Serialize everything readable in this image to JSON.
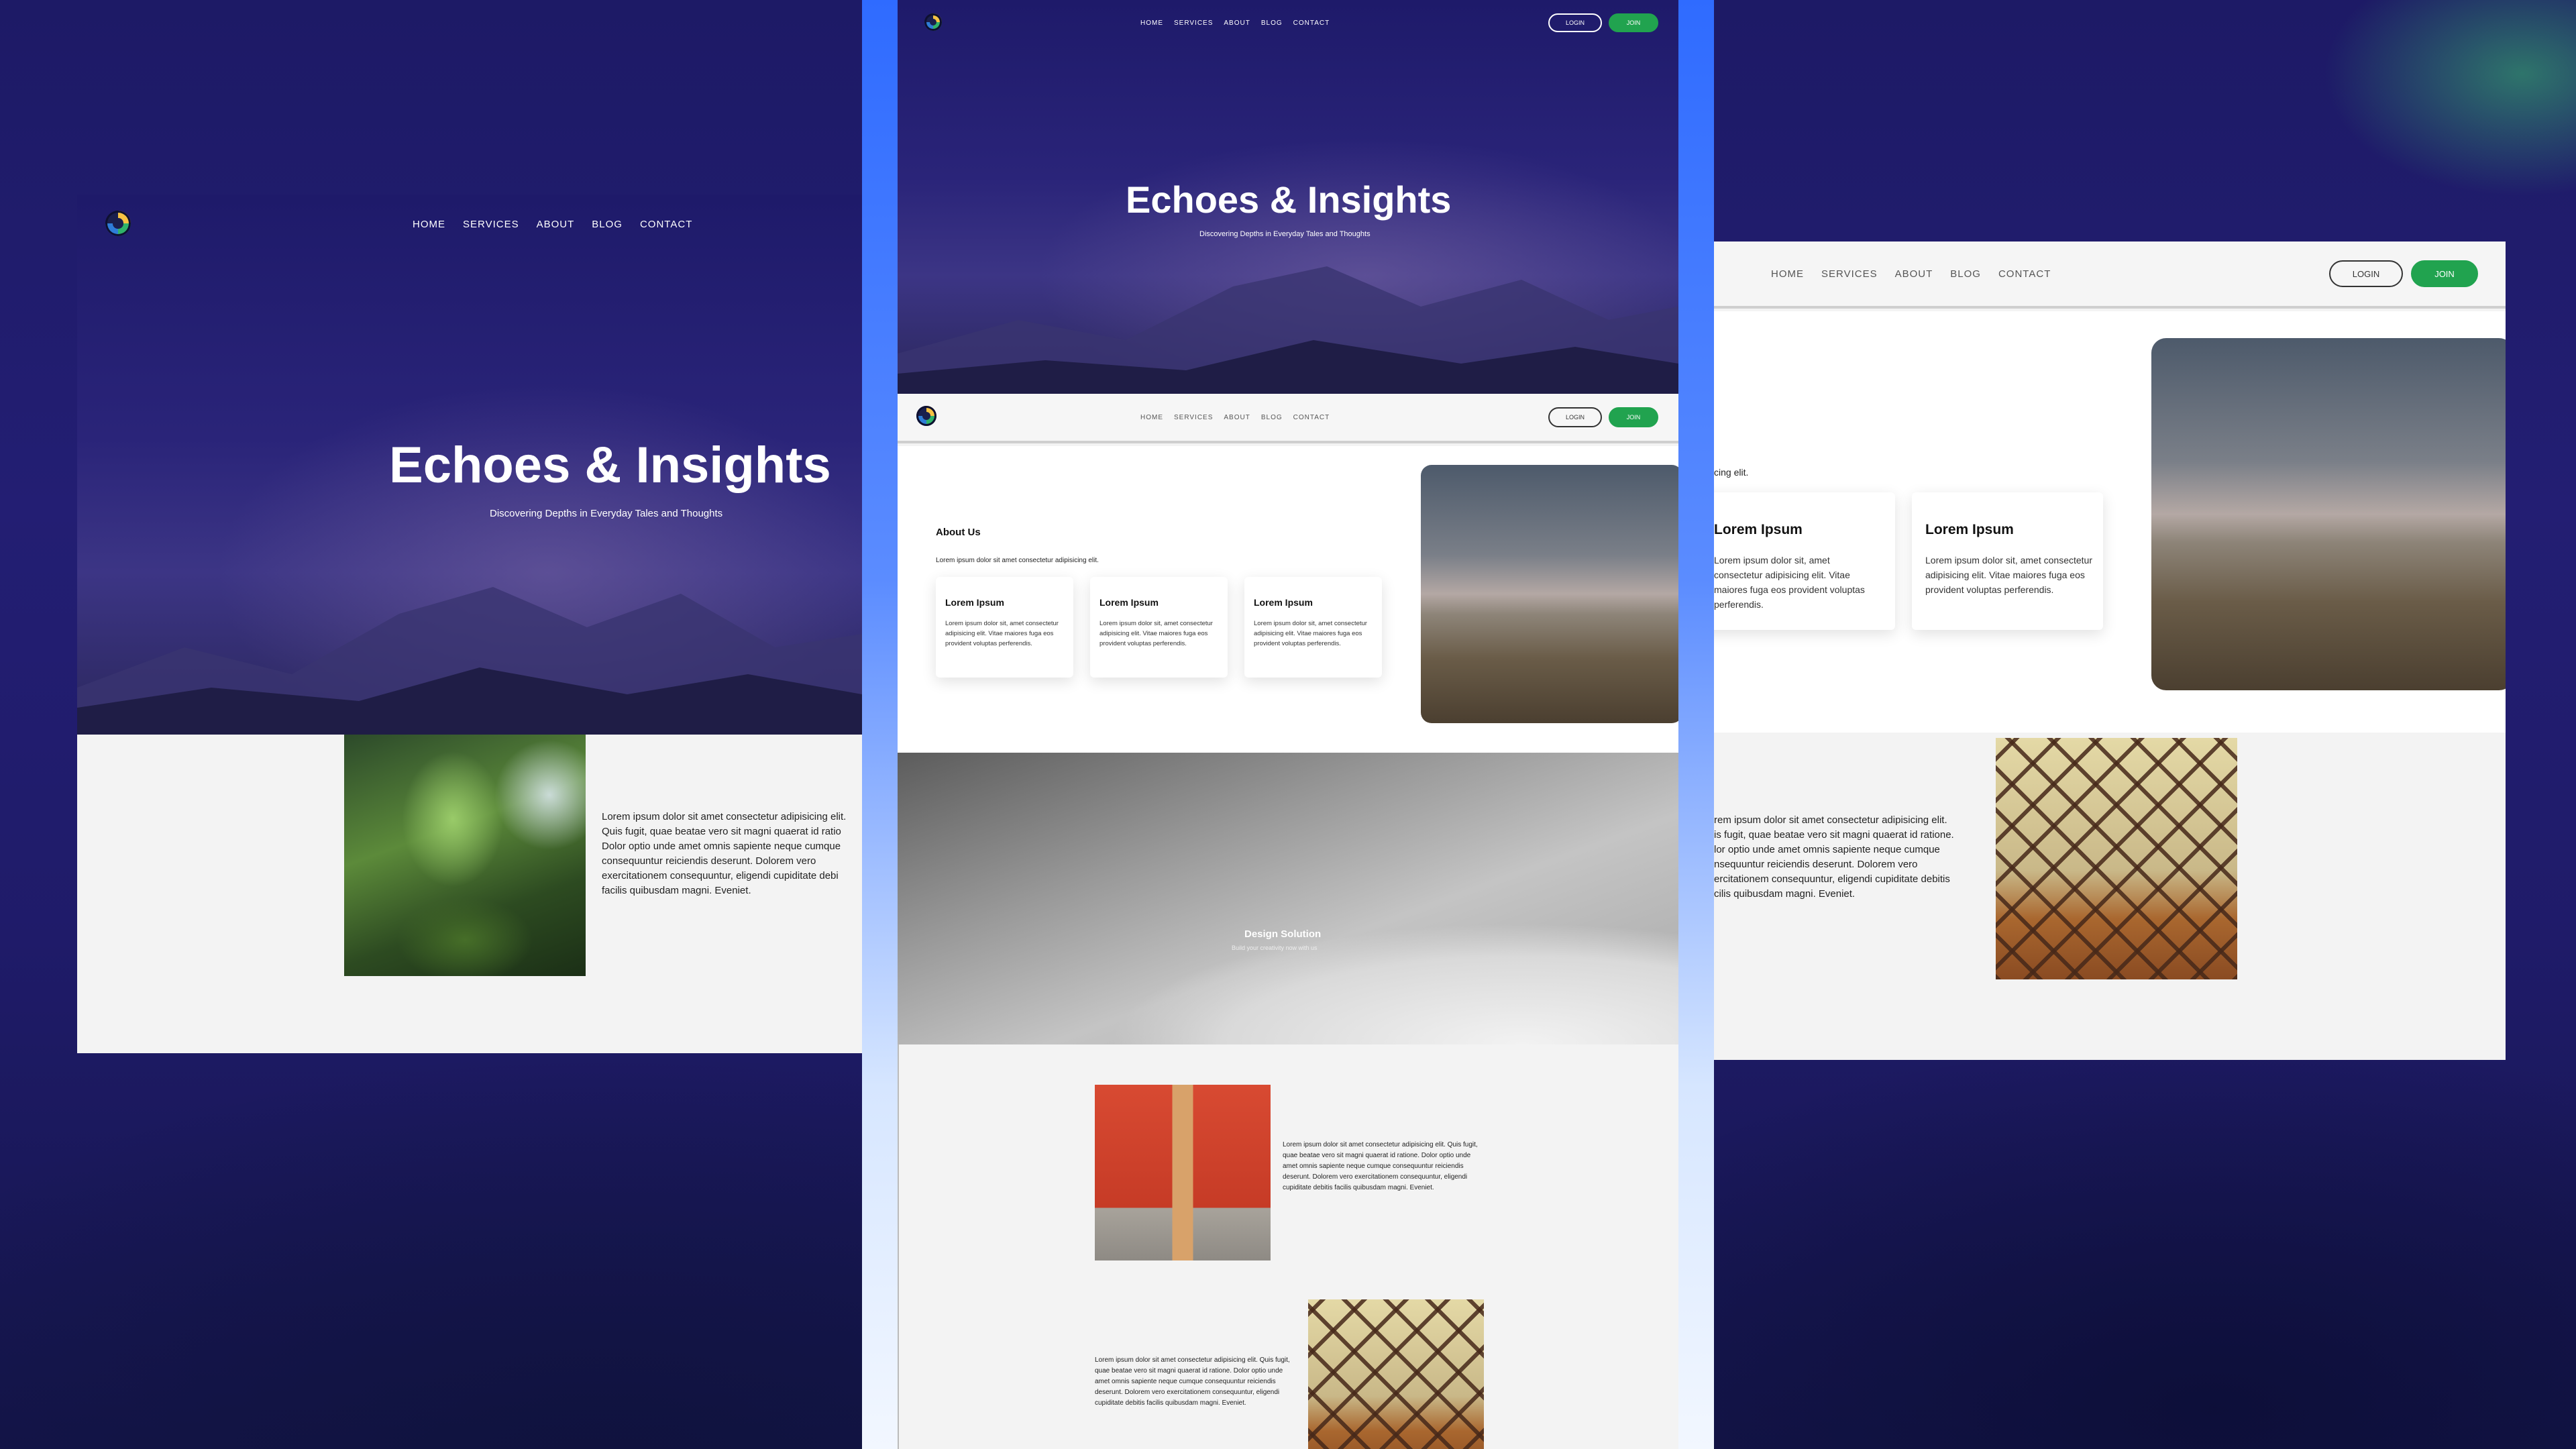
{
  "site": {
    "title": "Echoes & Insights",
    "subtitle": "Discovering Depths in Everyday Tales and Thoughts"
  },
  "nav": {
    "items": [
      "HOME",
      "SERVICES",
      "ABOUT",
      "BLOG",
      "CONTACT"
    ],
    "login_label": "LOGIN",
    "join_label": "JOIN"
  },
  "about": {
    "heading": "About Us",
    "intro": "Lorem ipsum dolor sit amet consectetur adipisicing elit.",
    "intro_fragment": "cing elit.",
    "cards": [
      {
        "title": "Lorem Ipsum",
        "body": "Lorem ipsum dolor sit, amet consectetur adipisicing elit. Vitae maiores fuga eos provident voluptas perferendis."
      },
      {
        "title": "Lorem Ipsum",
        "body": "Lorem ipsum dolor sit, amet consectetur adipisicing elit. Vitae maiores fuga eos provident voluptas perferendis."
      },
      {
        "title": "Lorem Ipsum",
        "body": "Lorem ipsum dolor sit, amet consectetur adipisicing elit. Vitae maiores fuga eos provident voluptas perferendis."
      }
    ]
  },
  "design": {
    "title": "Design Solution",
    "subtitle": "Build your creativity now with us"
  },
  "content": {
    "paragraph": "Lorem ipsum dolor sit amet consectetur adipisicing elit. Quis fugit, quae beatae vero sit magni quaerat id ratione. Dolor optio unde amet omnis sapiente neque cumque consequuntur reiciendis deserunt. Dolorem vero exercitationem consequuntur, eligendi cupiditate debitis facilis quibusdam magni. Eveniet.",
    "left_lines": [
      "Lorem ipsum dolor sit amet consectetur adipisicing elit.",
      "Quis fugit, quae beatae vero sit magni quaerat id ratio",
      "Dolor optio unde amet omnis sapiente neque cumque",
      "consequuntur reiciendis deserunt. Dolorem vero",
      "exercitationem consequuntur, eligendi cupiditate debi",
      "facilis quibusdam magni. Eveniet."
    ],
    "right_lines": [
      "rem ipsum dolor sit amet consectetur adipisicing elit.",
      "is fugit, quae beatae vero sit magni quaerat id ratione.",
      "lor optio unde amet omnis sapiente neque cumque",
      "nsequuntur reiciendis deserunt. Dolorem vero",
      "ercitationem consequuntur, eligendi cupiditate debitis",
      "cilis quibusdam magni. Eveniet."
    ]
  },
  "colors": {
    "background": "#1f1b69",
    "accent_green": "#21a34f",
    "blue_frame": "#1b5cff"
  }
}
